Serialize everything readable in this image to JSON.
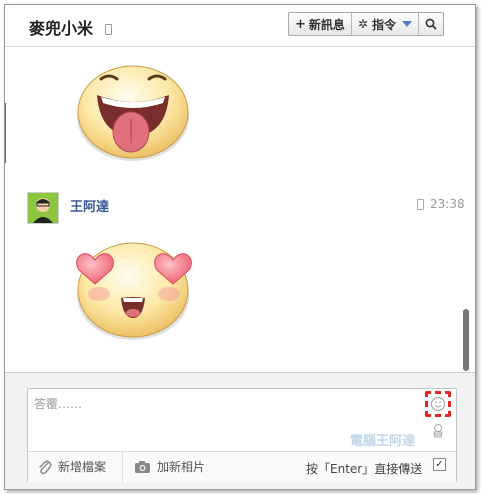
{
  "header": {
    "title": "麥兜小米",
    "new_message_label": "新訊息",
    "commands_label": "指令"
  },
  "chat": {
    "sender_name": "王阿達",
    "timestamp": "23:38",
    "stickers": [
      "tongue-out-face-sticker",
      "heart-eyes-face-sticker"
    ]
  },
  "composer": {
    "placeholder": "答覆……",
    "add_file_label": "新增檔案",
    "add_photo_label": "加新相片",
    "enter_to_send_label": "按「Enter」直接傳送",
    "enter_to_send_checked": true
  },
  "watermark": "電腦王阿達",
  "colors": {
    "accent": "#3b5998",
    "highlight_dashed": "#e8251f",
    "sidebar_bar": "#4d6ab0"
  }
}
